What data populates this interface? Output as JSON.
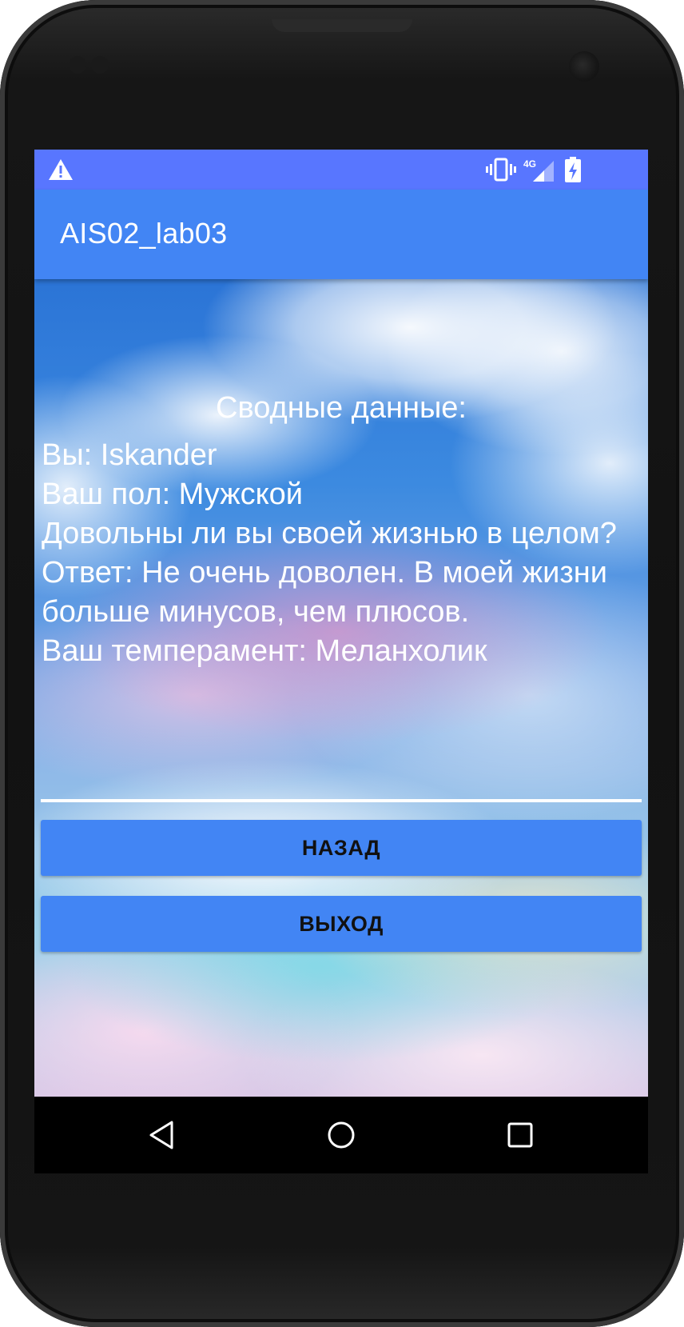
{
  "status_bar": {
    "color": "#5876ff",
    "icons": [
      "warning-icon",
      "vibrate-icon",
      "signal-4g-icon",
      "battery-charging-icon"
    ],
    "network_label": "4G"
  },
  "app_bar": {
    "title": "AIS02_lab03",
    "color": "#4285f4"
  },
  "summary": {
    "title": "Сводные данные:",
    "lines": [
      "Вы: Iskander",
      "Ваш пол: Мужской",
      "Довольны ли вы своей жизнью в целом?",
      "Ответ: Не очень доволен. В моей жизни больше минусов, чем плюсов.",
      "Ваш темперамент: Меланхолик"
    ]
  },
  "buttons": {
    "back_label": "НАЗАД",
    "exit_label": "ВЫХОД",
    "color": "#4285f4"
  },
  "nav_bar": {
    "icons": [
      "back-triangle-icon",
      "home-circle-icon",
      "recents-square-icon"
    ]
  }
}
